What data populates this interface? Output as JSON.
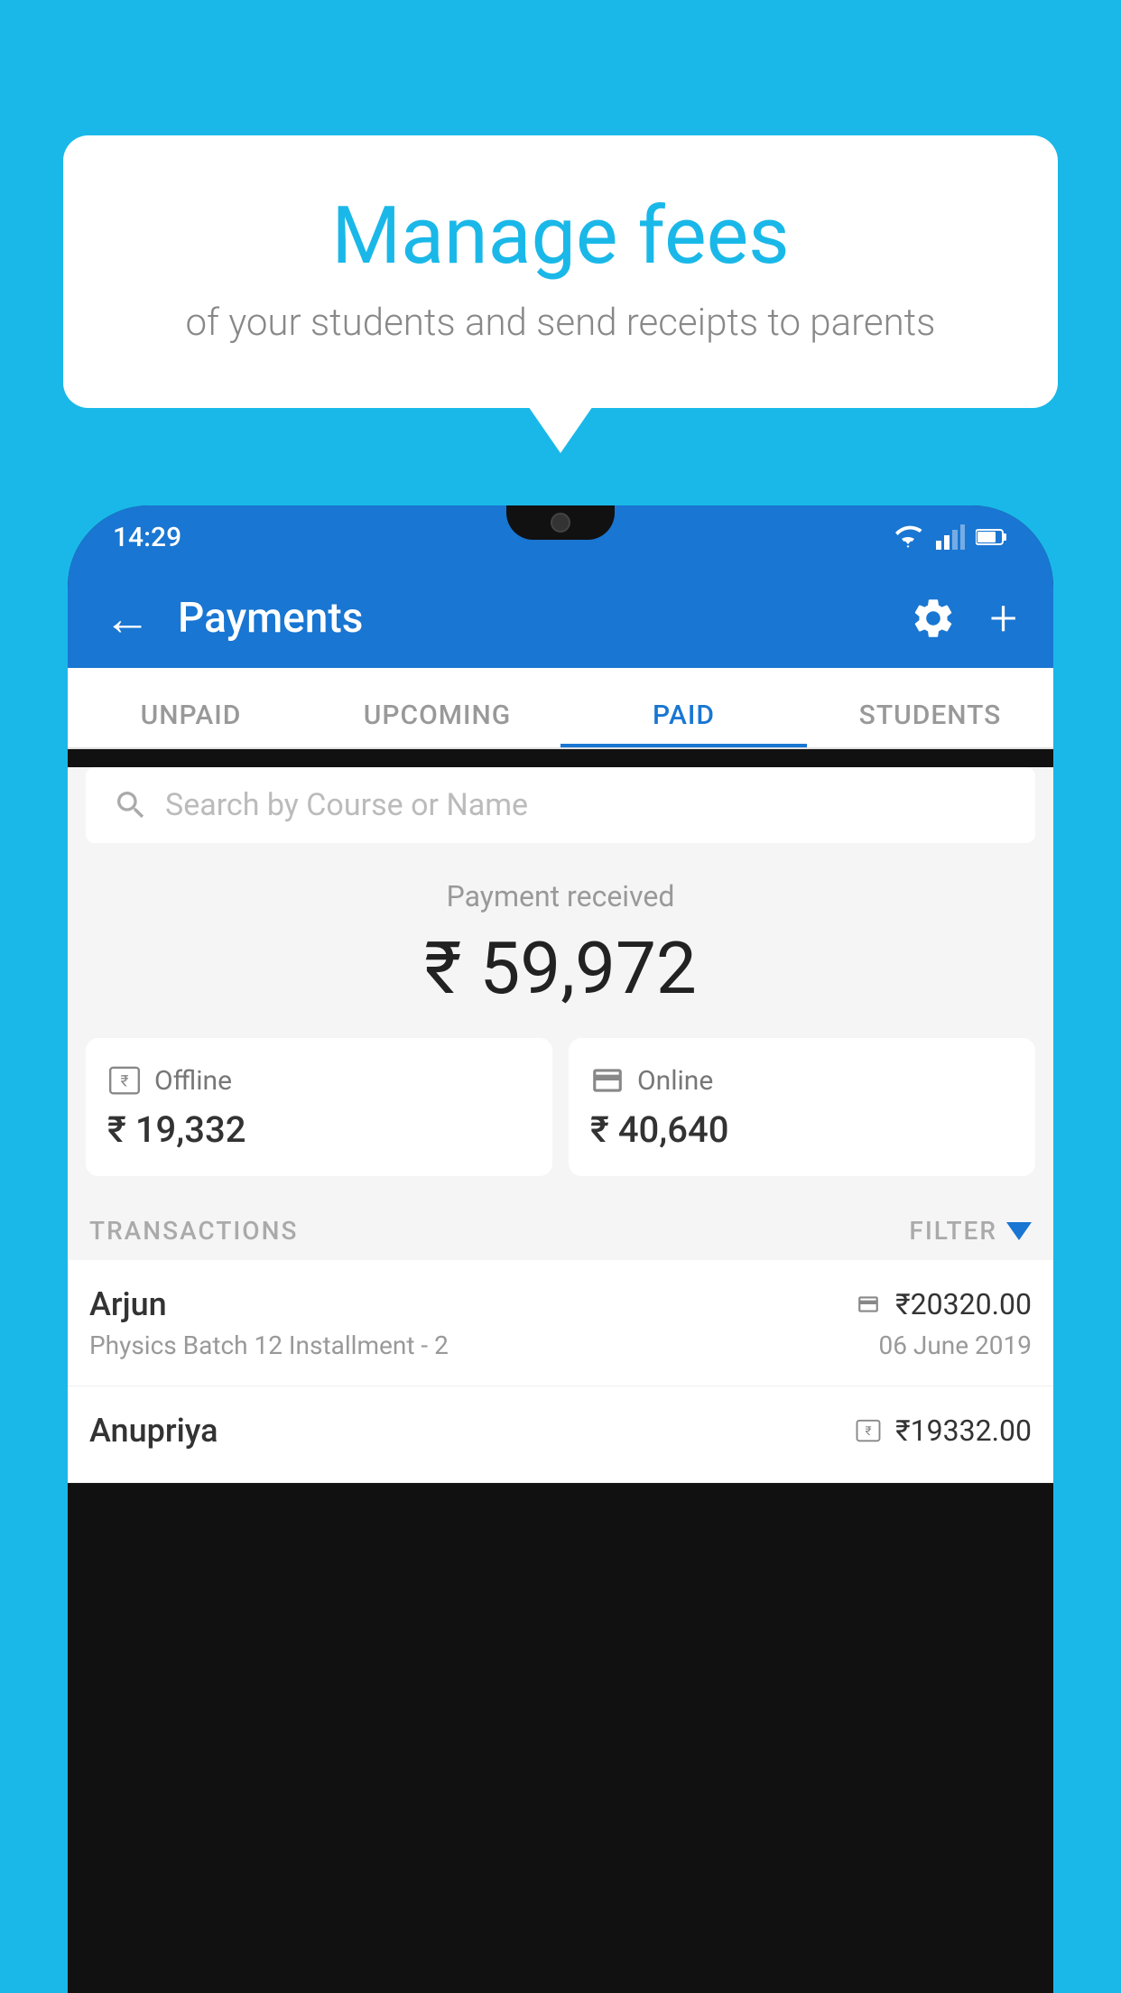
{
  "page": {
    "background_color": "#1ab8e8"
  },
  "bubble": {
    "title": "Manage fees",
    "subtitle": "of your students and send receipts to parents"
  },
  "status_bar": {
    "time": "14:29"
  },
  "app_bar": {
    "title": "Payments",
    "back_label": "←"
  },
  "tabs": [
    {
      "label": "UNPAID",
      "active": false
    },
    {
      "label": "UPCOMING",
      "active": false
    },
    {
      "label": "PAID",
      "active": true
    },
    {
      "label": "STUDENTS",
      "active": false
    }
  ],
  "search": {
    "placeholder": "Search by Course or Name"
  },
  "payment_received": {
    "label": "Payment received",
    "amount": "₹ 59,972"
  },
  "payment_cards": [
    {
      "type": "Offline",
      "amount": "₹ 19,332",
      "icon_type": "rupee-box"
    },
    {
      "type": "Online",
      "amount": "₹ 40,640",
      "icon_type": "card"
    }
  ],
  "transactions_section": {
    "label": "TRANSACTIONS",
    "filter_label": "FILTER"
  },
  "transactions": [
    {
      "name": "Arjun",
      "course": "Physics Batch 12 Installment - 2",
      "amount": "₹20320.00",
      "date": "06 June 2019",
      "icon_type": "card"
    },
    {
      "name": "Anupriya",
      "course": "",
      "amount": "₹19332.00",
      "date": "",
      "icon_type": "rupee-box"
    }
  ]
}
